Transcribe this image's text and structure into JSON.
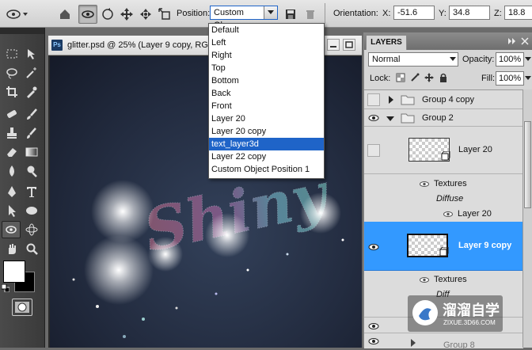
{
  "options_bar": {
    "position_label": "Position:",
    "position_value": "Custom Ob...",
    "orientation_label": "Orientation:",
    "x_label": "X:",
    "x_value": "-51.6",
    "y_label": "Y:",
    "y_value": "34.8",
    "z_label": "Z:",
    "z_value": "18.8"
  },
  "position_menu": {
    "items": [
      "Default",
      "Left",
      "Right",
      "Top",
      "Bottom",
      "Back",
      "Front",
      "Layer 20",
      "Layer 20 copy",
      "text_layer3d",
      "Layer 22 copy",
      "Custom Object Position 1"
    ],
    "selected": "text_layer3d"
  },
  "document": {
    "tab_icon": "Ps",
    "title": "glitter.psd @ 25% (Layer 9 copy, RG",
    "artwork_text": "Shiny"
  },
  "layers_panel": {
    "tab": "LAYERS",
    "blend_mode": "Normal",
    "opacity_label": "Opacity:",
    "opacity_value": "100%",
    "lock_label": "Lock:",
    "fill_label": "Fill:",
    "fill_value": "100%",
    "rows": [
      {
        "name": "Group 4 copy"
      },
      {
        "name": "Group 2"
      },
      {
        "name": "Layer 20"
      },
      {
        "name": "Textures"
      },
      {
        "name": "Diffuse"
      },
      {
        "name": "Layer 20"
      },
      {
        "name": "Layer 9 copy"
      },
      {
        "name": "Textures"
      },
      {
        "name": "Diff"
      },
      {
        "name": "Group 8"
      }
    ]
  },
  "watermark": {
    "brand": "溜溜自学",
    "url": "ZIXUE.3D66.COM"
  },
  "colors": {
    "selection_blue": "#3399ff",
    "menu_highlight": "#1f64c8",
    "canvas_dark": "#1c2233"
  }
}
